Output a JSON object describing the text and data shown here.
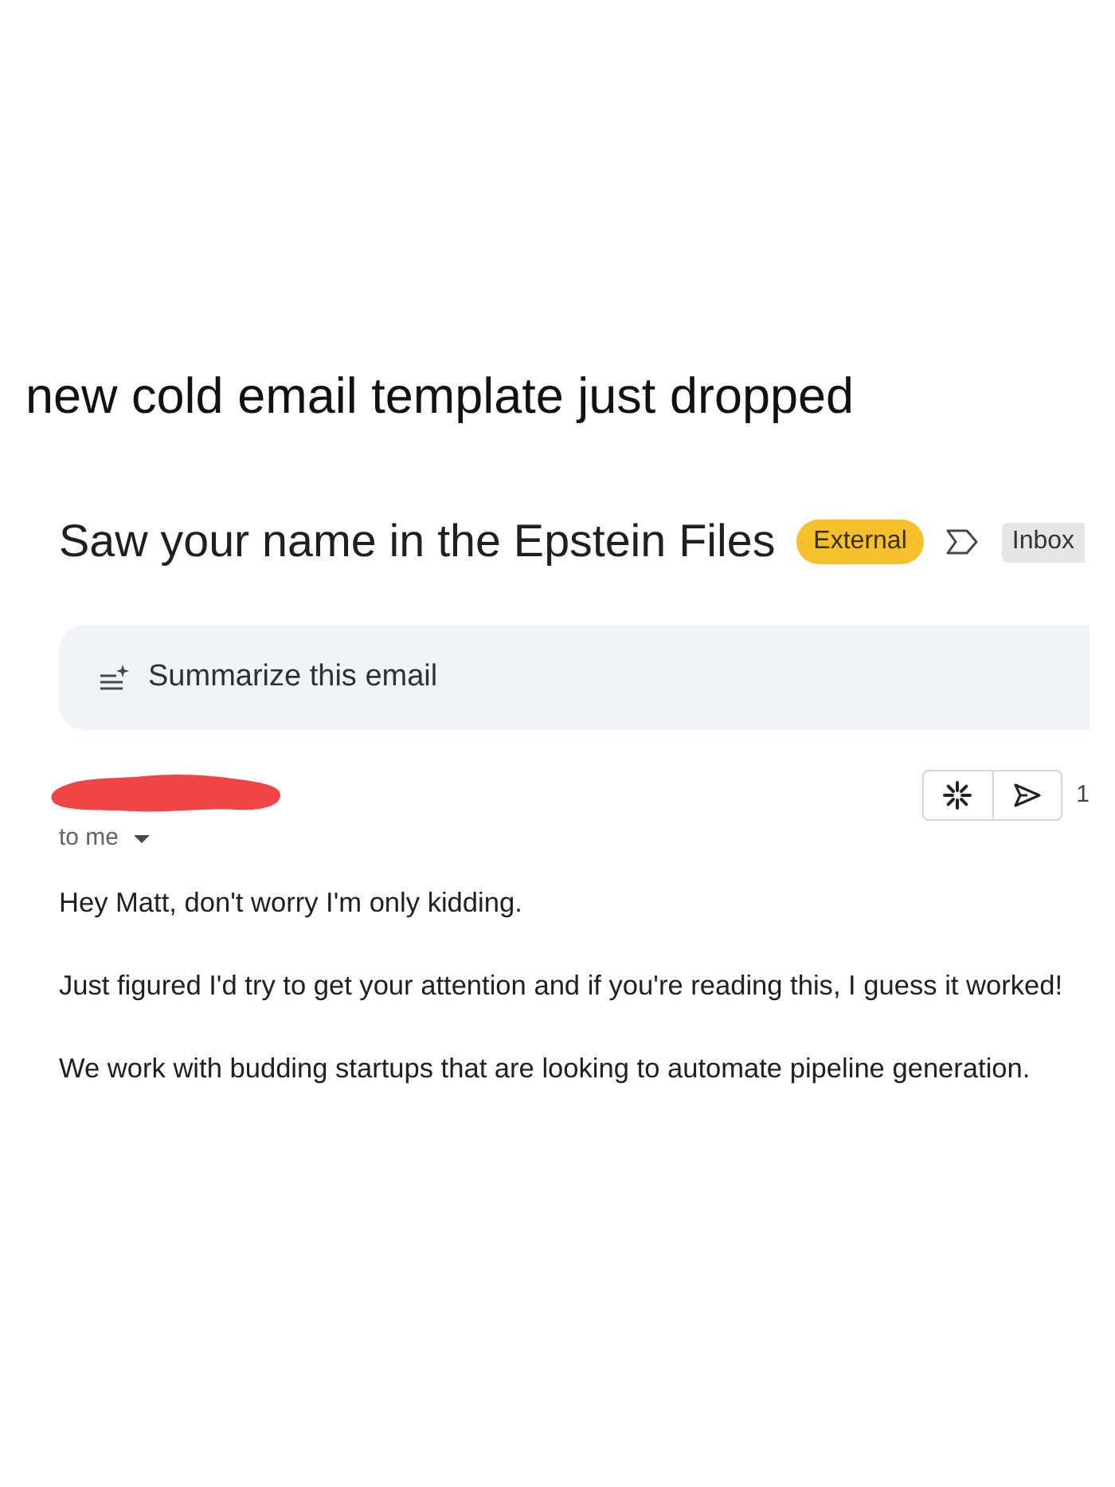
{
  "caption": "new cold email template just dropped",
  "email": {
    "subject": "Saw your name in the Epstein Files",
    "external_badge": "External",
    "important": false,
    "folder_labels": [
      "Inbox"
    ],
    "summarize": {
      "label": "Summarize this email"
    },
    "time": "1",
    "recipient": "to me",
    "body": [
      "Hey Matt, don't worry I'm only kidding.",
      "Just figured I'd try to get your attention and if you're reading this, I guess it worked!",
      "We work with budding startups that are looking to automate pipeline generation."
    ]
  }
}
